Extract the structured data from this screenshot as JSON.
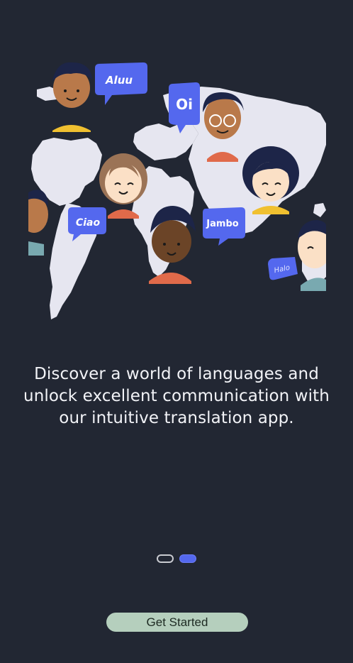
{
  "greetings": {
    "aluu": "Aluu",
    "oi": "Oi",
    "ciao": "Ciao",
    "jambo": "Jambo",
    "halo": "Halo"
  },
  "tagline": {
    "line1": "Discover a world of languages and",
    "line2": "unlock excellent communication with",
    "line3": "our intuitive translation app."
  },
  "pager": {
    "total": 2,
    "active_index": 1
  },
  "cta": {
    "label": "Get Started"
  },
  "colors": {
    "background": "#222733",
    "map": "#e6e6f0",
    "bubble": "#5468ee",
    "accent": "#5468ee",
    "button": "#b5cfbd"
  }
}
